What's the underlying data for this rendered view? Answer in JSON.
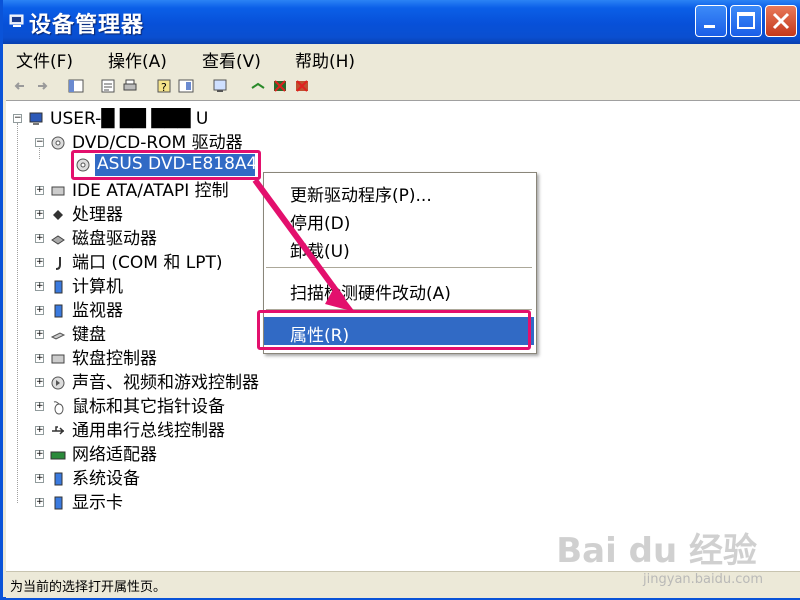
{
  "window": {
    "title": "设备管理器"
  },
  "menubar": {
    "items": [
      "文件(F)",
      "操作(A)",
      "查看(V)",
      "帮助(H)"
    ]
  },
  "tree": {
    "root": "USER-█ ██ ███ U",
    "nodes": [
      {
        "label": "DVD/CD-ROM 驱动器",
        "icon": "dvd-drive-icon"
      },
      {
        "label": "ASUS DVD-E818A4",
        "icon": "dvd-disc-icon"
      },
      {
        "label": "IDE ATA/ATAPI 控制",
        "icon": "ide-controller-icon"
      },
      {
        "label": "处理器",
        "icon": "processor-icon"
      },
      {
        "label": "磁盘驱动器",
        "icon": "disk-drive-icon"
      },
      {
        "label": "端口 (COM 和 LPT)",
        "icon": "port-icon"
      },
      {
        "label": "计算机",
        "icon": "computer-icon"
      },
      {
        "label": "监视器",
        "icon": "monitor-icon"
      },
      {
        "label": "键盘",
        "icon": "keyboard-icon"
      },
      {
        "label": "软盘控制器",
        "icon": "floppy-controller-icon"
      },
      {
        "label": "声音、视频和游戏控制器",
        "icon": "sound-icon"
      },
      {
        "label": "鼠标和其它指针设备",
        "icon": "mouse-icon"
      },
      {
        "label": "通用串行总线控制器",
        "icon": "usb-icon"
      },
      {
        "label": "网络适配器",
        "icon": "network-adapter-icon"
      },
      {
        "label": "系统设备",
        "icon": "system-device-icon"
      },
      {
        "label": "显示卡",
        "icon": "display-adapter-icon"
      }
    ]
  },
  "context_menu": {
    "items": [
      {
        "label": "更新驱动程序(P)..."
      },
      {
        "label": "停用(D)"
      },
      {
        "label": "卸载(U)"
      },
      {
        "label": "扫描检测硬件改动(A)"
      },
      {
        "label": "属性(R)"
      }
    ]
  },
  "status": {
    "text": "为当前的选择打开属性页。"
  },
  "watermark": {
    "main": "Bai du 经验",
    "sub": "jingyan.baidu.com"
  },
  "colors": {
    "titlebar": "#0a53d8",
    "highlight": "#316ac5",
    "annotation": "#e3106d"
  }
}
